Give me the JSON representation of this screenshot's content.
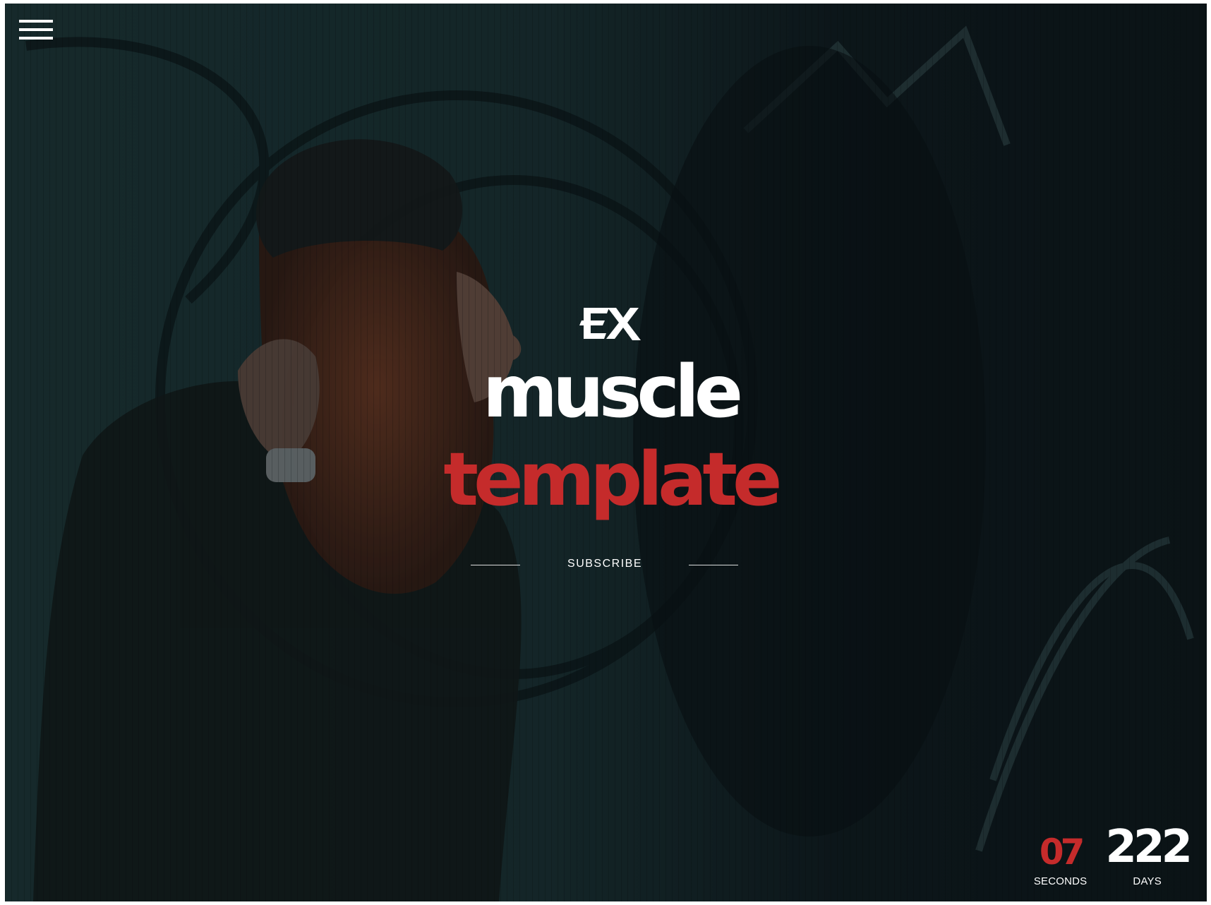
{
  "menu": {
    "icon": "hamburger-menu-icon"
  },
  "brand": {
    "logo_text": "EX",
    "title_line_1": "muscle",
    "title_line_2": "template",
    "accent_color": "#c52b2b"
  },
  "cta": {
    "subscribe_label": "SUBSCRIBE"
  },
  "countdown": {
    "seconds_value": "07",
    "seconds_label": "SECONDS",
    "days_value": "222",
    "days_label": "DAYS"
  },
  "background": {
    "description_colors": [
      "#0c1416",
      "#1b3134",
      "#2a4a4a"
    ]
  }
}
